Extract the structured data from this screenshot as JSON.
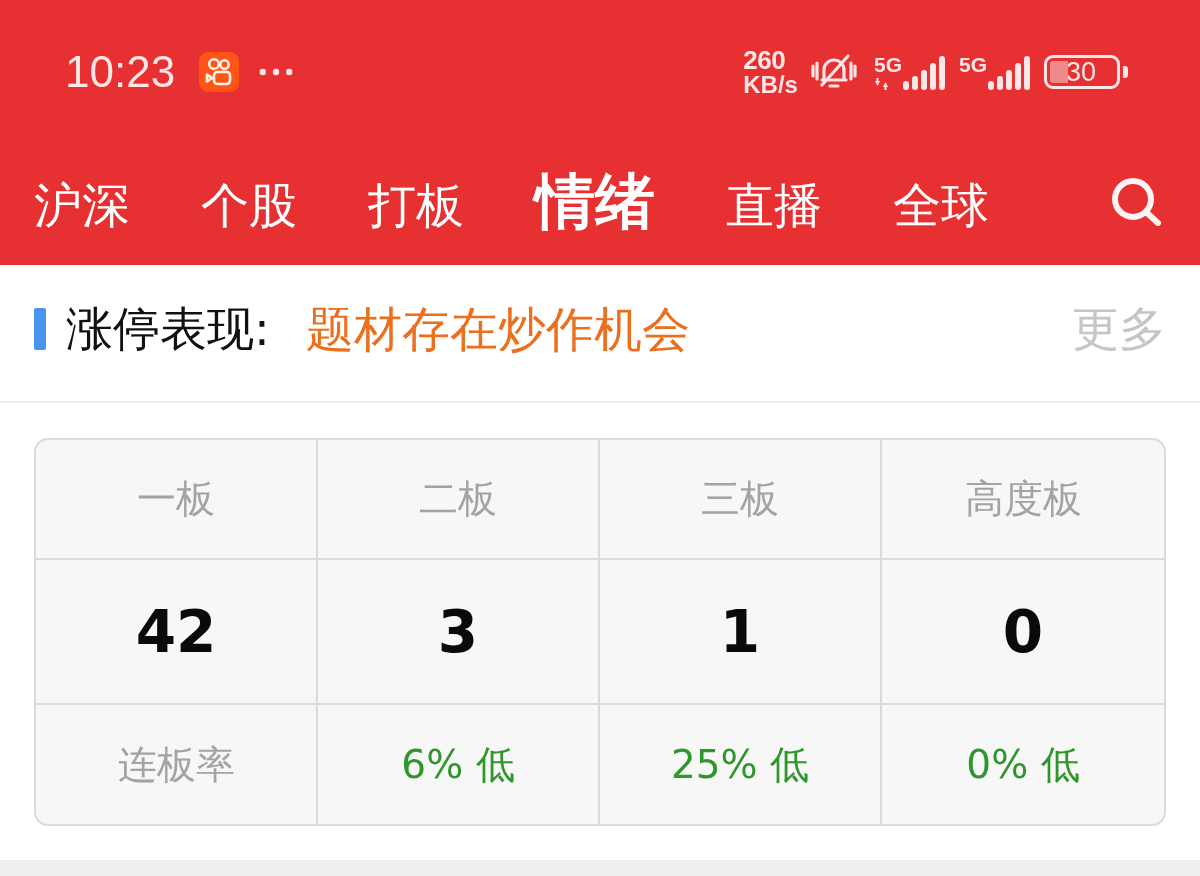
{
  "status_bar": {
    "time": "10:23",
    "speed": "260",
    "speed_unit": "KB/s",
    "sim_1": "5G",
    "sim_2": "5G",
    "battery": "30"
  },
  "tabs": [
    {
      "label": "沪深",
      "selected": false
    },
    {
      "label": "个股",
      "selected": false
    },
    {
      "label": "打板",
      "selected": false
    },
    {
      "label": "情绪",
      "selected": true
    },
    {
      "label": "直播",
      "selected": false
    },
    {
      "label": "全球",
      "selected": false
    }
  ],
  "section": {
    "title": "涨停表现:",
    "summary": "题材存在炒作机会",
    "more": "更多"
  },
  "table": {
    "columns": [
      "一板",
      "二板",
      "三板",
      "高度板"
    ],
    "counts": [
      "42",
      "3",
      "1",
      "0"
    ],
    "rate_label": "连板率",
    "rates": [
      "6% 低",
      "25% 低",
      "0% 低"
    ]
  }
}
